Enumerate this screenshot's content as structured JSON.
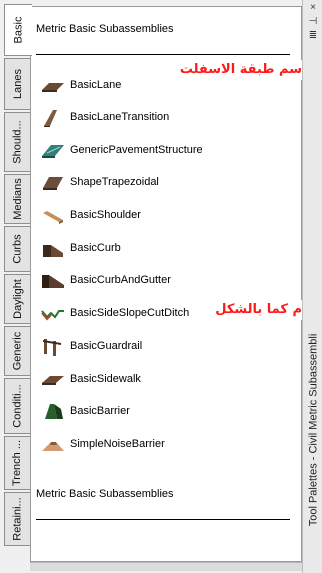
{
  "tabs": [
    {
      "label": "Basic",
      "active": true
    },
    {
      "label": "Lanes"
    },
    {
      "label": "Should..."
    },
    {
      "label": "Medians"
    },
    {
      "label": "Curbs"
    },
    {
      "label": "Daylight"
    },
    {
      "label": "Generic"
    },
    {
      "label": "Conditi..."
    },
    {
      "label": "Trench ..."
    },
    {
      "label": "Retaini..."
    }
  ],
  "palette": {
    "header_top": "Metric Basic Subassemblies",
    "header_bottom": "Metric Basic Subassemblies",
    "items": [
      {
        "label": "BasicLane",
        "icon": "lane-icon"
      },
      {
        "label": "BasicLaneTransition",
        "icon": "lane-transition-icon"
      },
      {
        "label": "GenericPavementStructure",
        "icon": "pavement-structure-icon"
      },
      {
        "label": "ShapeTrapezoidal",
        "icon": "trapezoid-icon"
      },
      {
        "label": "BasicShoulder",
        "icon": "shoulder-icon"
      },
      {
        "label": "BasicCurb",
        "icon": "curb-icon"
      },
      {
        "label": "BasicCurbAndGutter",
        "icon": "curb-gutter-icon"
      },
      {
        "label": "BasicSideSlopeCutDitch",
        "icon": "ditch-icon"
      },
      {
        "label": "BasicGuardrail",
        "icon": "guardrail-icon"
      },
      {
        "label": "BasicSidewalk",
        "icon": "sidewalk-icon"
      },
      {
        "label": "BasicBarrier",
        "icon": "barrier-icon"
      },
      {
        "label": "SimpleNoiseBarrier",
        "icon": "noise-barrier-icon"
      }
    ]
  },
  "notes": {
    "asphalt": "سم طبقة الاسفلت",
    "shape": "م كما بالشكل"
  },
  "window": {
    "title": "Tool Palettes - Civil Metric Subassembli",
    "close": "×",
    "pin": "⊣",
    "menu": "≣"
  },
  "colors": {
    "note": "#ff1a1a",
    "accent": "#6b4a33"
  }
}
